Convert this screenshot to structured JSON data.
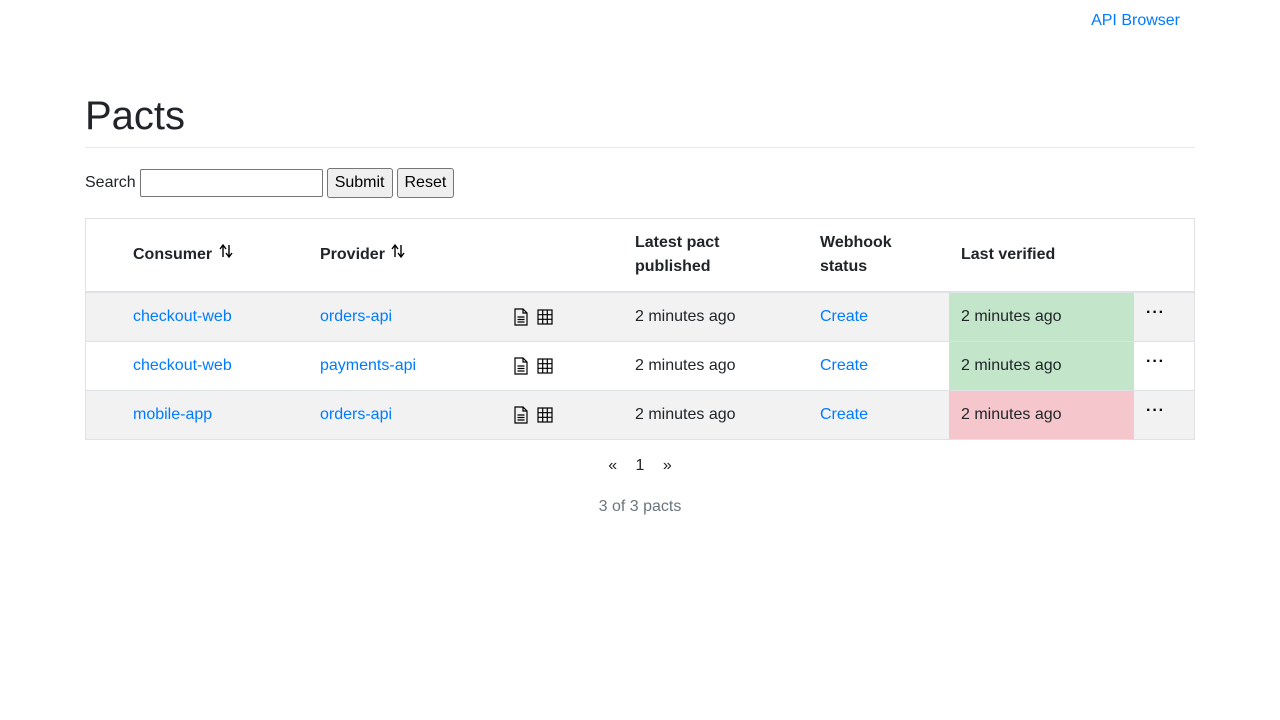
{
  "nav": {
    "api_browser": "API Browser"
  },
  "page": {
    "title": "Pacts"
  },
  "search": {
    "label": "Search",
    "value": "",
    "placeholder": "",
    "submit_label": "Submit",
    "reset_label": "Reset"
  },
  "table": {
    "headers": {
      "consumer": "Consumer",
      "provider": "Provider",
      "latest_pact": "Latest pact published",
      "webhook": "Webhook status",
      "last_verified": "Last verified"
    },
    "rows": [
      {
        "consumer": "checkout-web",
        "provider": "orders-api",
        "published": "2 minutes ago",
        "webhook": "Create",
        "verified": "2 minutes ago",
        "verified_status": "success",
        "actions": "···"
      },
      {
        "consumer": "checkout-web",
        "provider": "payments-api",
        "published": "2 minutes ago",
        "webhook": "Create",
        "verified": "2 minutes ago",
        "verified_status": "success",
        "actions": "···"
      },
      {
        "consumer": "mobile-app",
        "provider": "orders-api",
        "published": "2 minutes ago",
        "webhook": "Create",
        "verified": "2 minutes ago",
        "verified_status": "failure",
        "actions": "···"
      }
    ]
  },
  "pagination": {
    "prev": "«",
    "current": "1",
    "next": "»"
  },
  "summary": "3 of 3 pacts",
  "colors": {
    "link": "#007bff",
    "verified_success": "#c3e6cb",
    "verified_failure": "#f5c6cb",
    "row_stripe": "#f2f2f2"
  },
  "icons": [
    "sort-icon",
    "document-icon",
    "matrix-icon",
    "more-icon"
  ]
}
